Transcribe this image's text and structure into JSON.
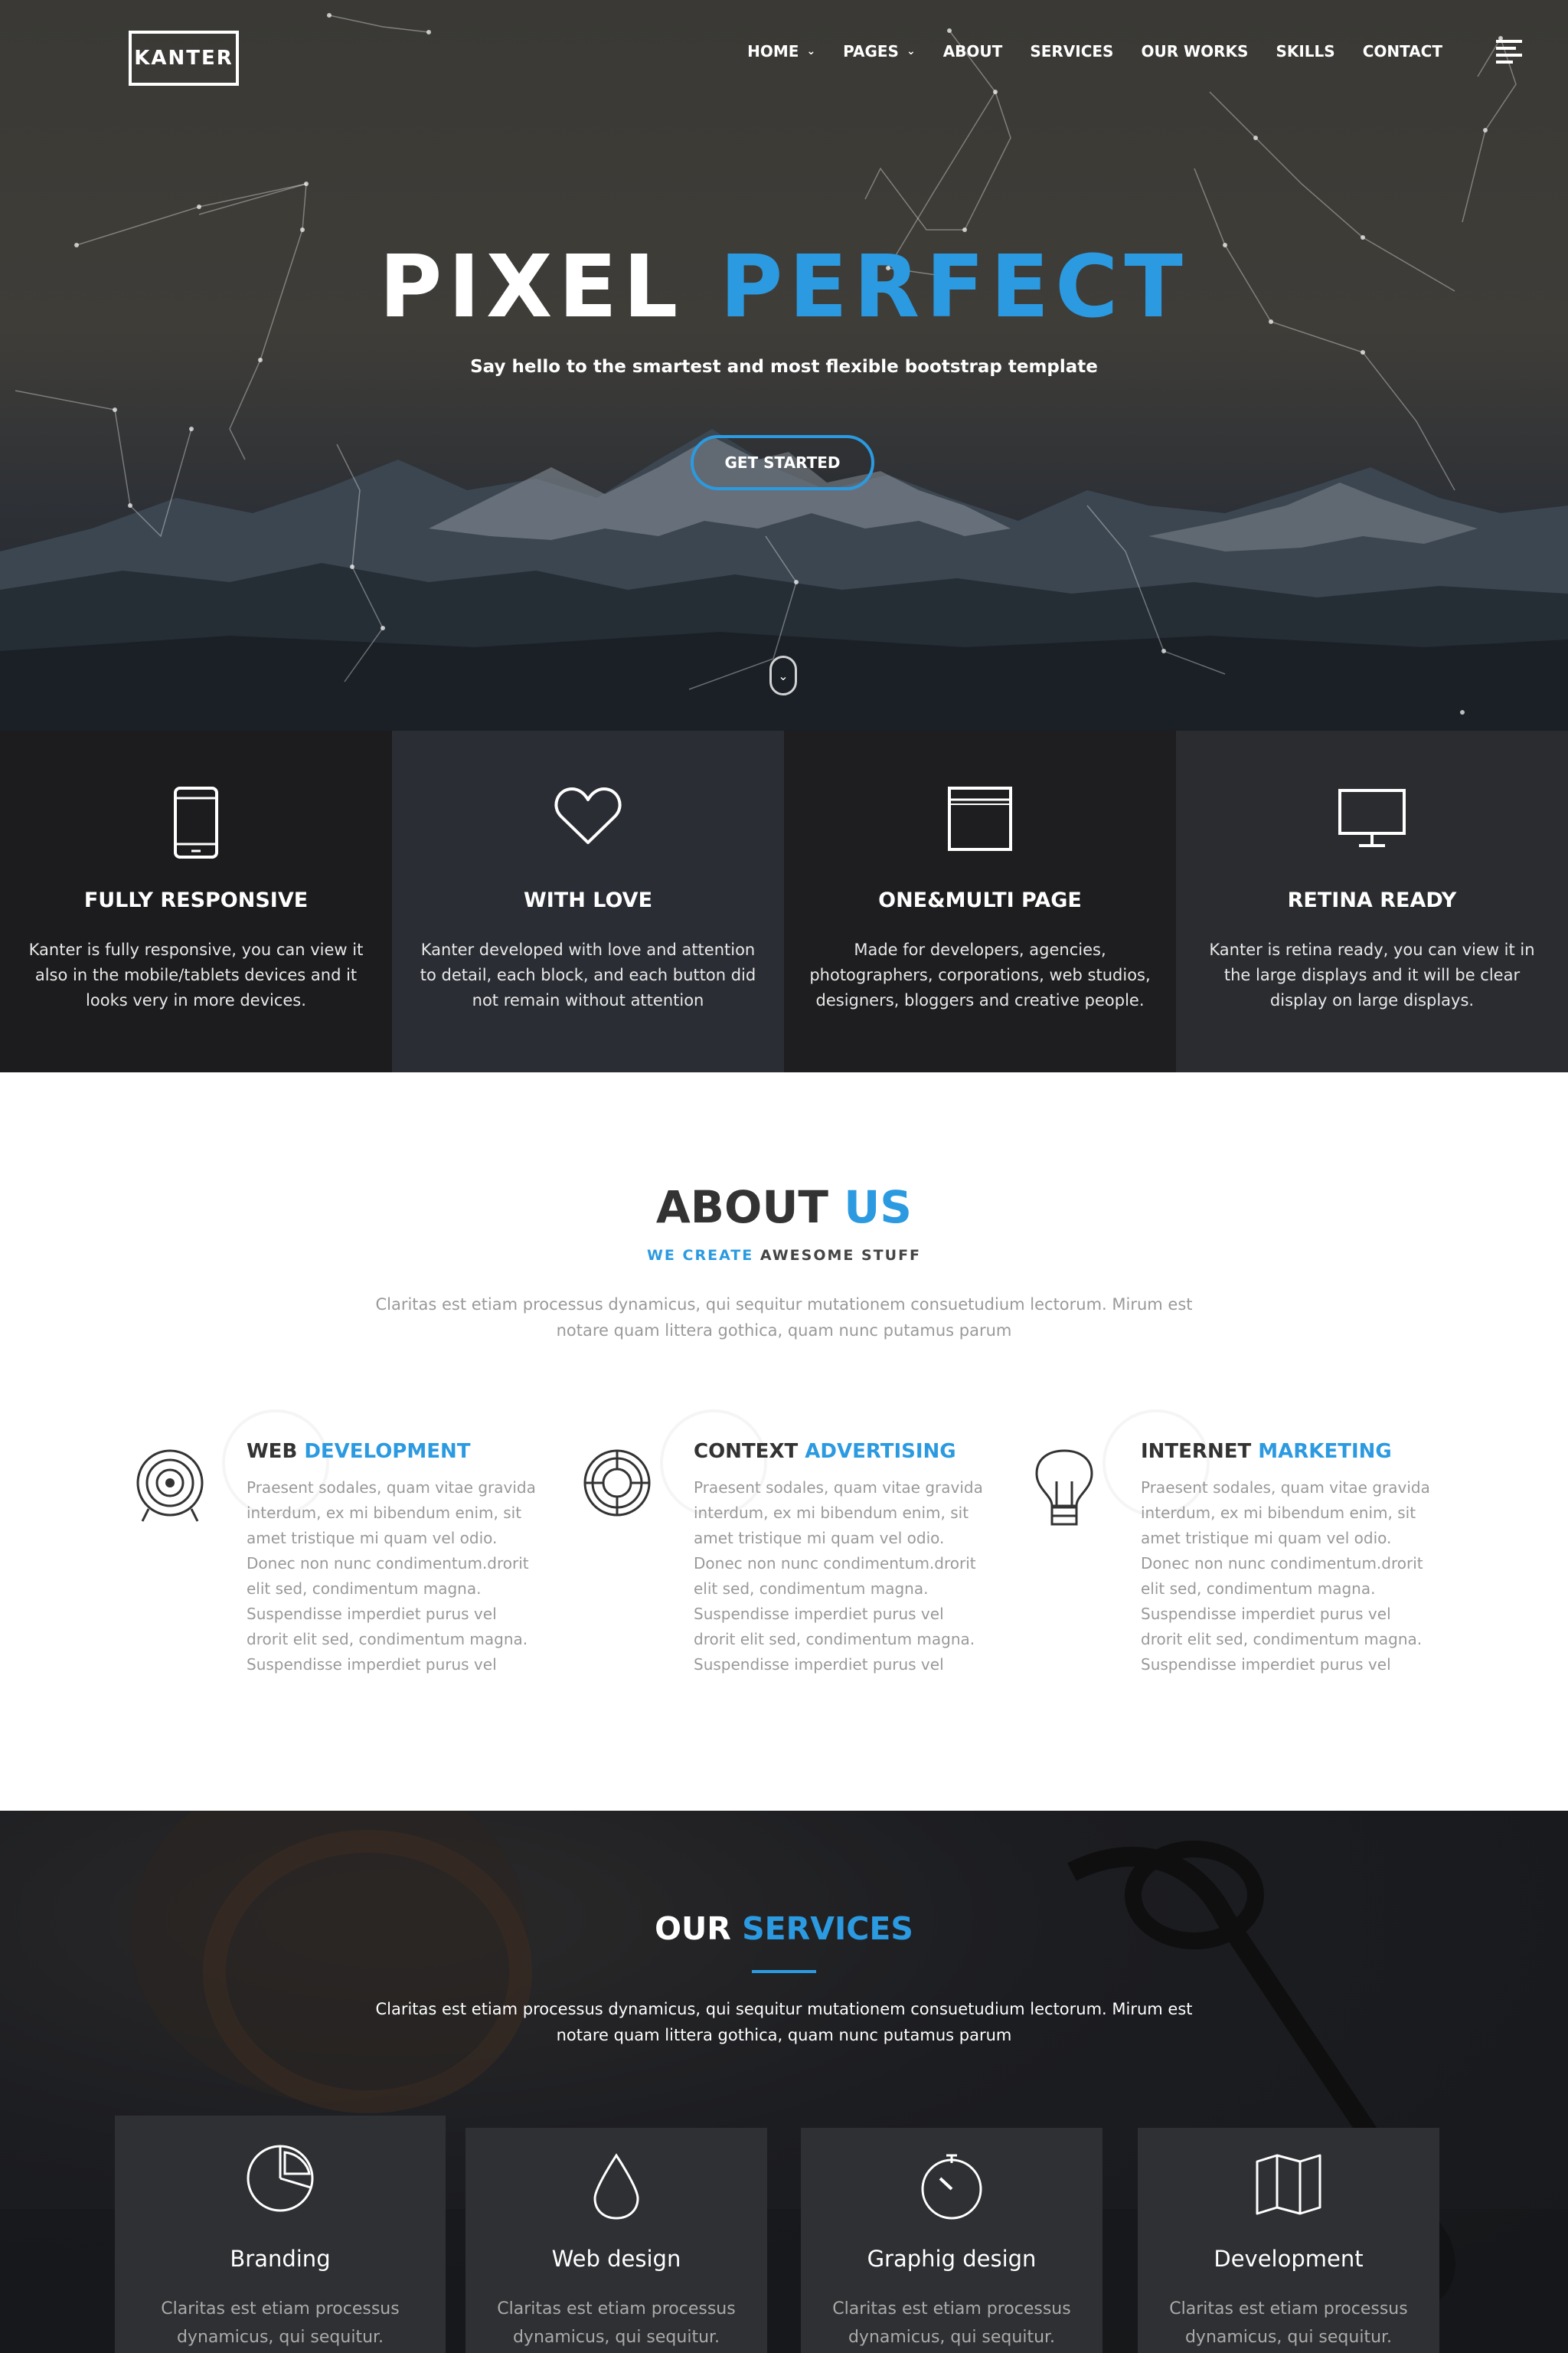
{
  "brand": {
    "logo": "KANTER"
  },
  "nav": {
    "items": [
      {
        "label": "HOME",
        "has_caret": true
      },
      {
        "label": "PAGES",
        "has_caret": true
      },
      {
        "label": "ABOUT"
      },
      {
        "label": "SERVICES"
      },
      {
        "label": "OUR WORKS"
      },
      {
        "label": "SKILLS"
      },
      {
        "label": "CONTACT"
      }
    ],
    "caret_glyph": "⌄",
    "menu_icon": "hamburger-icon"
  },
  "hero": {
    "title_white": "PIXEL",
    "title_accent": "PERFECT",
    "subtitle": "Say hello to the smartest and most flexible bootstrap template",
    "cta": "GET STARTED",
    "scroll_glyph": "⌄"
  },
  "features": [
    {
      "icon": "smartphone-icon",
      "title": "FULLY RESPONSIVE",
      "text": "Kanter is fully responsive, you can view it also in the mobile/tablets devices and it looks very in more devices."
    },
    {
      "icon": "heart-icon",
      "title": "WITH LOVE",
      "text": "Kanter developed with love and attention to detail, each block, and each button did not remain without attention"
    },
    {
      "icon": "browser-window-icon",
      "title": "ONE&MULTI PAGE",
      "text": "Made for developers, agencies, photographers, corporations, web studios, designers, bloggers and creative people."
    },
    {
      "icon": "monitor-icon",
      "title": "RETINA READY",
      "text": "Kanter is retina ready, you can view it in the large displays and it will be clear display on large displays."
    }
  ],
  "about": {
    "title_dark": "ABOUT",
    "title_accent": "US",
    "tag_accent": "WE CREATE",
    "tag_dark": "AWESOME STUFF",
    "description": "Claritas est etiam processus dynamicus, qui sequitur mutationem consuetudium lectorum. Mirum est notare quam littera gothica, quam nunc putamus parum",
    "services": [
      {
        "icon": "target-icon",
        "title_dark": "WEB",
        "title_accent": "DEVELOPMENT",
        "text": "Praesent sodales, quam vitae gravida interdum, ex mi bibendum enim, sit amet tristique mi quam vel odio. Donec non nunc condimentum.drorit elit sed, condimentum magna. Suspendisse imperdiet purus vel drorit elit sed, condimentum magna. Suspendisse imperdiet purus vel"
      },
      {
        "icon": "lifebuoy-icon",
        "title_dark": "CONTEXT",
        "title_accent": "ADVERTISING",
        "text": "Praesent sodales, quam vitae gravida interdum, ex mi bibendum enim, sit amet tristique mi quam vel odio. Donec non nunc condimentum.drorit elit sed, condimentum magna. Suspendisse imperdiet purus vel drorit elit sed, condimentum magna. Suspendisse imperdiet purus vel"
      },
      {
        "icon": "lightbulb-icon",
        "title_dark": "INTERNET",
        "title_accent": "MARKETING",
        "text": "Praesent sodales, quam vitae gravida interdum, ex mi bibendum enim, sit amet tristique mi quam vel odio. Donec non nunc condimentum.drorit elit sed, condimentum magna. Suspendisse imperdiet purus vel drorit elit sed, condimentum magna. Suspendisse imperdiet purus vel"
      }
    ]
  },
  "our_services": {
    "title_white": "OUR",
    "title_accent": "SERVICES",
    "description": "Claritas est etiam processus dynamicus, qui sequitur mutationem consuetudium lectorum. Mirum est notare quam littera gothica, quam nunc putamus parum",
    "cards": [
      {
        "icon": "pie-chart-icon",
        "title": "Branding",
        "text": "Claritas est etiam processus dynamicus, qui sequitur."
      },
      {
        "icon": "drop-icon",
        "title": "Web design",
        "text": "Claritas est etiam processus dynamicus, qui sequitur."
      },
      {
        "icon": "timer-icon",
        "title": "Graphig design",
        "text": "Claritas est etiam processus dynamicus, qui sequitur."
      },
      {
        "icon": "map-icon",
        "title": "Development",
        "text": "Claritas est etiam processus dynamicus, qui sequitur."
      }
    ]
  },
  "colors": {
    "accent": "#2b9ae0",
    "dark_text": "#333333",
    "muted_text": "#999999"
  }
}
